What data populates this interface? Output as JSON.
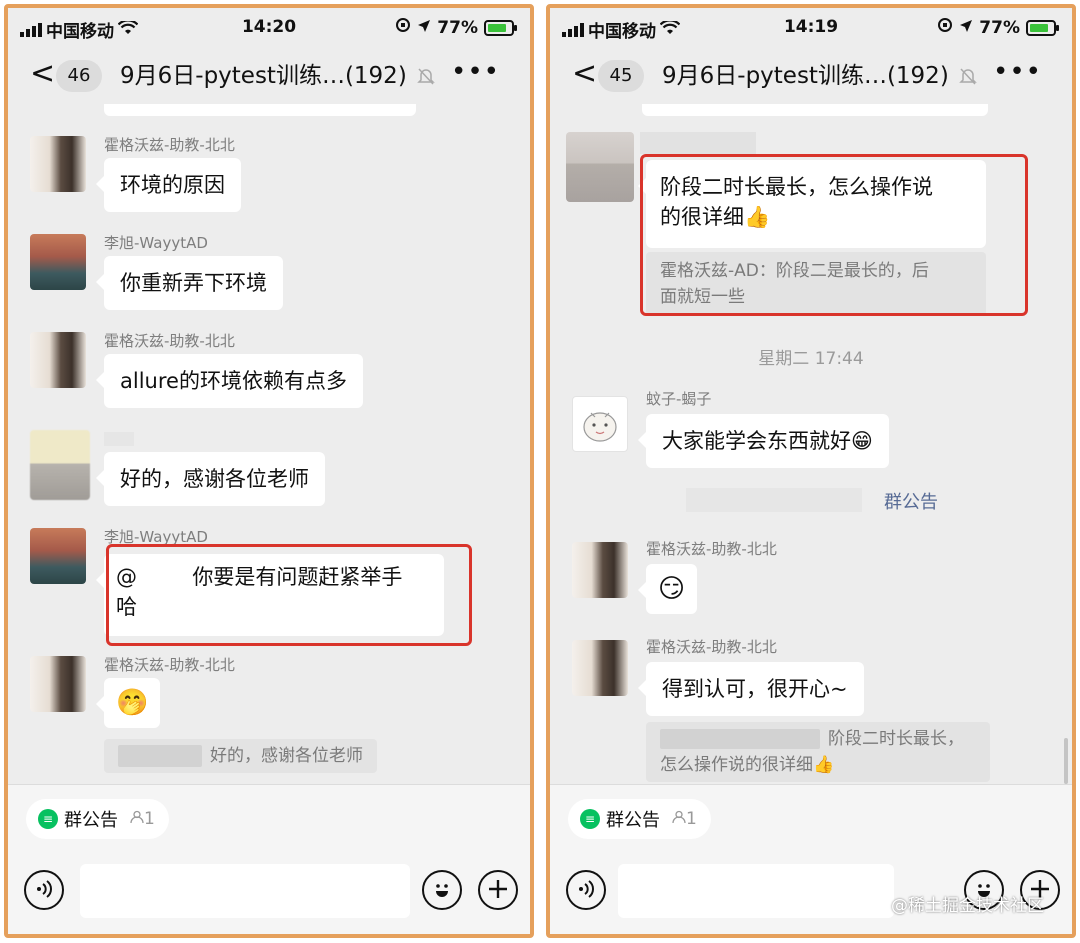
{
  "left": {
    "status": {
      "carrier": "中国移动",
      "time": "14:20",
      "battery": "77%"
    },
    "nav": {
      "back": "<",
      "unread": "46",
      "title": "9月6日-pytest训练…(192)",
      "more": "•••"
    },
    "messages": [
      {
        "sender": "霍格沃兹-助教-北北",
        "text": "环境的原因"
      },
      {
        "sender": "李旭-WayytAD",
        "text": "你重新弄下环境"
      },
      {
        "sender": "霍格沃兹-助教-北北",
        "text": "allure的环境依赖有点多"
      },
      {
        "text": "好的，感谢各位老师"
      },
      {
        "sender": "李旭-WayytAD",
        "text_line1": "@ 　　  你要是有问题赶紧举手",
        "text_line2": "哈"
      },
      {
        "sender": "霍格沃兹-助教-北北",
        "emoji": "🤭",
        "quote": "好的，感谢各位老师"
      }
    ],
    "bottom": {
      "notice_label": "群公告",
      "notice_count": "1"
    }
  },
  "right": {
    "status": {
      "carrier": "中国移动",
      "time": "14:19",
      "battery": "77%"
    },
    "nav": {
      "back": "<",
      "unread": "45",
      "title": "9月6日-pytest训练…(192)",
      "more": "•••"
    },
    "messages": [
      {
        "text_line1": "阶段二时长最长，怎么操作说",
        "text_line2": "的很详细👍",
        "quote_line1": "霍格沃兹-AD：阶段二是最长的，后",
        "quote_line2": "面就短一些"
      },
      {
        "sender": "蚊子-蝎子",
        "text": "大家能学会东西就好😁"
      },
      {
        "sender": "霍格沃兹-助教-北北",
        "emoji": "😏"
      },
      {
        "sender": "霍格沃兹-助教-北北",
        "text": "得到认可，很开心~",
        "quote_line1": "阶段二时长最长，",
        "quote_line2": "怎么操作说的很详细👍"
      }
    ],
    "time_divider": "星期二 17:44",
    "notice_link": "群公告",
    "bottom": {
      "notice_label": "群公告",
      "notice_count": "1"
    },
    "watermark": "@稀土掘金技术社区"
  }
}
